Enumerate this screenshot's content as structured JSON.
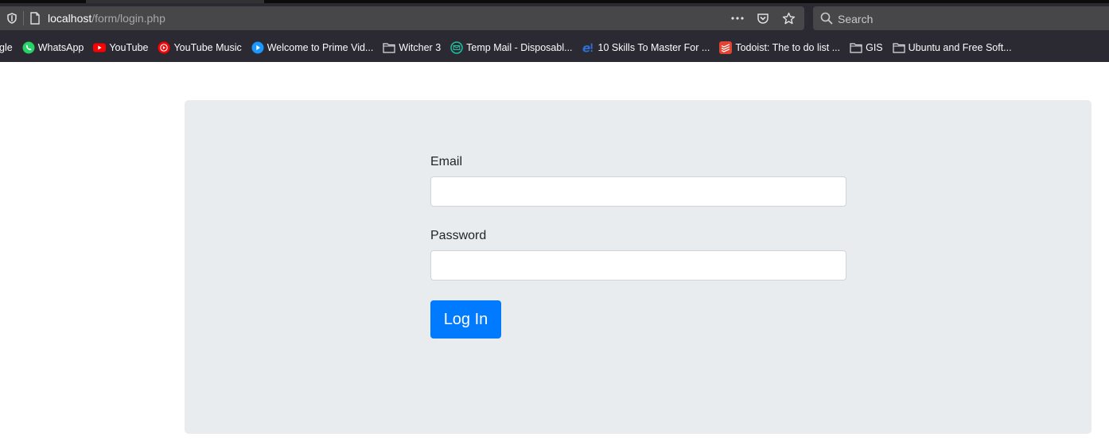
{
  "browser": {
    "url_host": "localhost",
    "url_path": "/form/login.php",
    "search_placeholder": "Search",
    "url_actions": [
      "more-icon",
      "pocket-icon",
      "bookmark-star-icon"
    ]
  },
  "bookmarks": [
    {
      "label": "gle",
      "icon": "google-icon"
    },
    {
      "label": "WhatsApp",
      "icon": "whatsapp-icon",
      "color": "#25d366"
    },
    {
      "label": "YouTube",
      "icon": "youtube-icon",
      "color": "#ff0000"
    },
    {
      "label": "YouTube Music",
      "icon": "youtube-music-icon",
      "color": "#ff0000"
    },
    {
      "label": "Welcome to Prime Vid...",
      "icon": "prime-video-icon",
      "color": "#1a98ff"
    },
    {
      "label": "Witcher 3",
      "icon": "folder-icon"
    },
    {
      "label": "Temp Mail - Disposabl...",
      "icon": "temp-mail-icon",
      "color": "#20c0a0"
    },
    {
      "label": "10 Skills To Master For ...",
      "icon": "e-icon",
      "color": "#2f6fd6"
    },
    {
      "label": "Todoist: The to do list ...",
      "icon": "todoist-icon",
      "color": "#e44332"
    },
    {
      "label": "GIS",
      "icon": "folder-icon"
    },
    {
      "label": "Ubuntu and Free Soft...",
      "icon": "folder-icon"
    }
  ],
  "form": {
    "email_label": "Email",
    "email_value": "",
    "password_label": "Password",
    "password_value": "",
    "submit_label": "Log In"
  },
  "colors": {
    "card_bg": "#e9ecef",
    "primary": "#007bff",
    "chrome_bg": "#2b2a33"
  }
}
